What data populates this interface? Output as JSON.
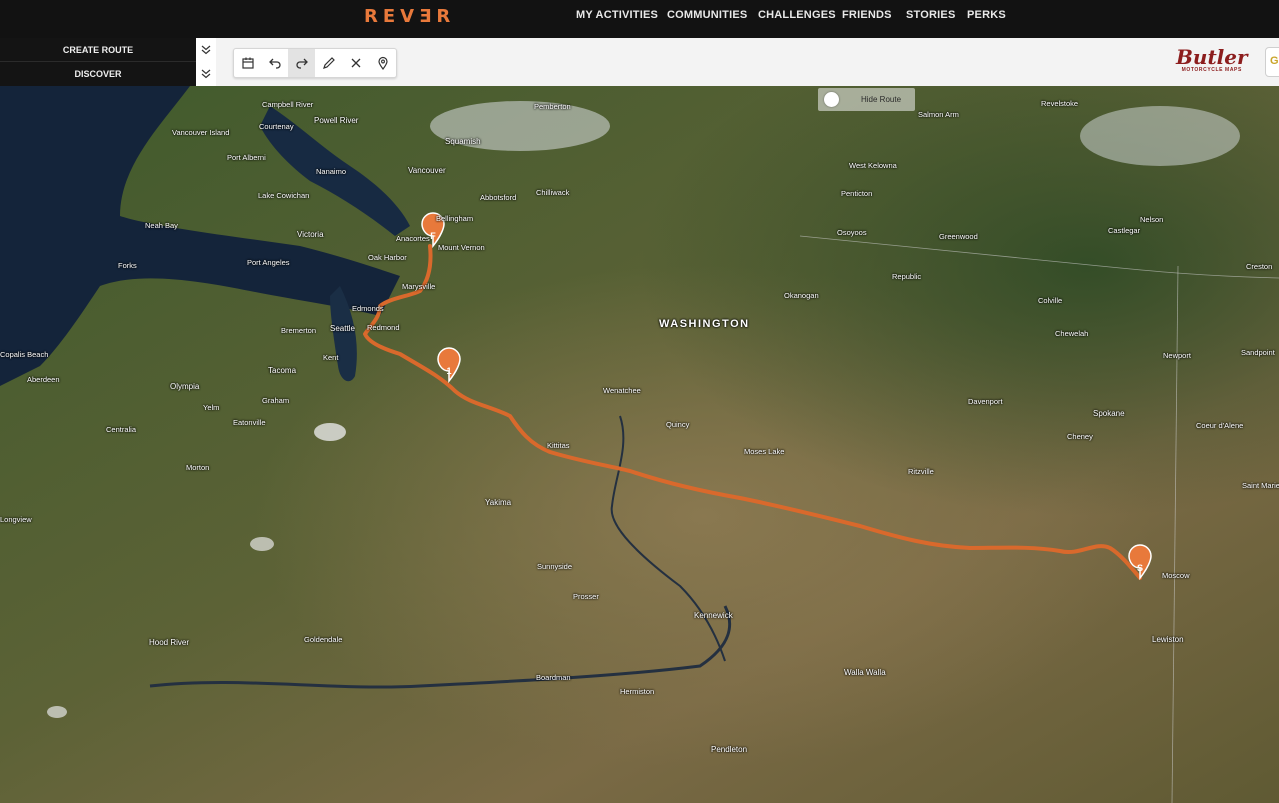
{
  "brand": {
    "logo": "REVƎR",
    "accent": "#e8793b"
  },
  "nav": [
    {
      "label": "MY ACTIVITIES"
    },
    {
      "label": "COMMUNITIES"
    },
    {
      "label": "CHALLENGES"
    },
    {
      "label": "FRIENDS"
    },
    {
      "label": "STORIES"
    },
    {
      "label": "PERKS"
    }
  ],
  "panel": {
    "create_route": "CREATE ROUTE",
    "discover": "DISCOVER"
  },
  "toolbar": {
    "tools": [
      "calendar-icon",
      "undo-icon",
      "redo-icon",
      "pencil-icon",
      "close-icon",
      "map-pin-icon"
    ]
  },
  "partner": {
    "name": "Butler",
    "subtitle": "MOTORCYCLE MAPS"
  },
  "map": {
    "hide_route_label": "Hide Route",
    "region_label": "WASHINGTON",
    "route_color": "#d9692c",
    "markers": {
      "finish": "F",
      "waypoint": "1",
      "start": "S"
    },
    "places": [
      {
        "name": "Campbell River"
      },
      {
        "name": "Powell River"
      },
      {
        "name": "Vancouver Island"
      },
      {
        "name": "Courtenay"
      },
      {
        "name": "Port Alberni"
      },
      {
        "name": "Nanaimo"
      },
      {
        "name": "Squamish"
      },
      {
        "name": "Lake Cowichan"
      },
      {
        "name": "Vancouver"
      },
      {
        "name": "Abbotsford"
      },
      {
        "name": "Chilliwack"
      },
      {
        "name": "Pemberton"
      },
      {
        "name": "Neah Bay"
      },
      {
        "name": "Victoria"
      },
      {
        "name": "Bellingham"
      },
      {
        "name": "Anacortes"
      },
      {
        "name": "Mount Vernon"
      },
      {
        "name": "Oak Harbor"
      },
      {
        "name": "Port Angeles"
      },
      {
        "name": "Forks"
      },
      {
        "name": "Marysville"
      },
      {
        "name": "Edmonds"
      },
      {
        "name": "Bremerton"
      },
      {
        "name": "Seattle"
      },
      {
        "name": "Redmond"
      },
      {
        "name": "Kent"
      },
      {
        "name": "Copalis Beach"
      },
      {
        "name": "Aberdeen"
      },
      {
        "name": "Olympia"
      },
      {
        "name": "Tacoma"
      },
      {
        "name": "Yelm"
      },
      {
        "name": "Graham"
      },
      {
        "name": "Centralia"
      },
      {
        "name": "Eatonville"
      },
      {
        "name": "Morton"
      },
      {
        "name": "Longview"
      },
      {
        "name": "Kittitas"
      },
      {
        "name": "Yakima"
      },
      {
        "name": "Sunnyside"
      },
      {
        "name": "Prosser"
      },
      {
        "name": "Kennewick"
      },
      {
        "name": "Goldendale"
      },
      {
        "name": "Hood River"
      },
      {
        "name": "Boardman"
      },
      {
        "name": "Hermiston"
      },
      {
        "name": "Pendleton"
      },
      {
        "name": "Walla Walla"
      },
      {
        "name": "Wenatchee"
      },
      {
        "name": "Quincy"
      },
      {
        "name": "Moses Lake"
      },
      {
        "name": "Ritzville"
      },
      {
        "name": "Davenport"
      },
      {
        "name": "Spokane"
      },
      {
        "name": "Cheney"
      },
      {
        "name": "Coeur d'Alene"
      },
      {
        "name": "Newport"
      },
      {
        "name": "Sandpoint"
      },
      {
        "name": "Saint Maries"
      },
      {
        "name": "Moscow"
      },
      {
        "name": "Lewiston"
      },
      {
        "name": "Okanogan"
      },
      {
        "name": "Osoyoos"
      },
      {
        "name": "Republic"
      },
      {
        "name": "Colville"
      },
      {
        "name": "Chewelah"
      },
      {
        "name": "Greenwood"
      },
      {
        "name": "Penticton"
      },
      {
        "name": "West Kelowna"
      },
      {
        "name": "Salmon Arm"
      },
      {
        "name": "Revelstoke"
      },
      {
        "name": "Castlegar"
      },
      {
        "name": "Nelson"
      },
      {
        "name": "Creston"
      }
    ]
  }
}
